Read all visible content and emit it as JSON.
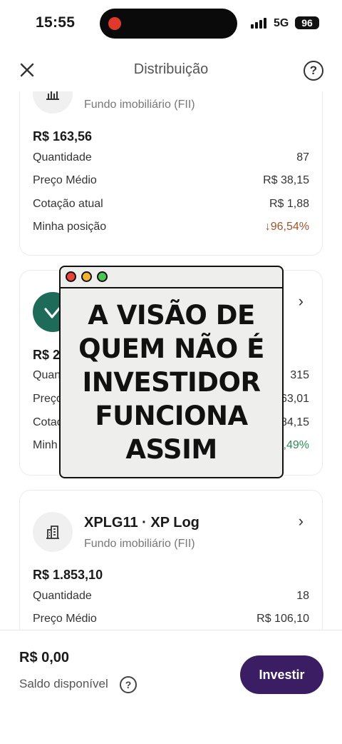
{
  "status_bar": {
    "time": "15:55",
    "network": "5G",
    "battery": "96"
  },
  "header": {
    "title": "Distribuição",
    "help": "?"
  },
  "cards": [
    {
      "type": "Fundo imobiliário (FII)",
      "total": "R$ 163,56",
      "rows": [
        {
          "label": "Quantidade",
          "value": "87"
        },
        {
          "label": "Preço Médio",
          "value": "R$ 38,15"
        },
        {
          "label": "Cotação atual",
          "value": "R$ 1,88"
        },
        {
          "label": "Minha posição",
          "value": "↓96,54%"
        }
      ]
    },
    {
      "total": "R$ 2",
      "rows": [
        {
          "label": "Quan",
          "value": "315"
        },
        {
          "label": "Preço",
          "value": "63,01"
        },
        {
          "label": "Cotaç",
          "value": "84,15"
        },
        {
          "label": "Minh",
          "value": "3,49%"
        }
      ]
    },
    {
      "name": "XPLG11 · XP Log",
      "type": "Fundo imobiliário (FII)",
      "total": "R$ 1.853,10",
      "rows": [
        {
          "label": "Quantidade",
          "value": "18"
        },
        {
          "label": "Preço Médio",
          "value": "R$ 106,10"
        }
      ]
    }
  ],
  "footer": {
    "balance": "R$ 0,00",
    "balance_label": "Saldo disponível",
    "help": "?",
    "invest_label": "Investir"
  },
  "overlay": {
    "lines": [
      "A VISÃO DE",
      "QUEM NÃO É",
      "INVESTIDOR",
      "FUNCIONA",
      "ASSIM"
    ]
  },
  "colors": {
    "invest_button": "#3b1d63",
    "negative": "#a0522d",
    "positive": "#2e8b57",
    "asset_icon_green": "#1f6b5a"
  }
}
